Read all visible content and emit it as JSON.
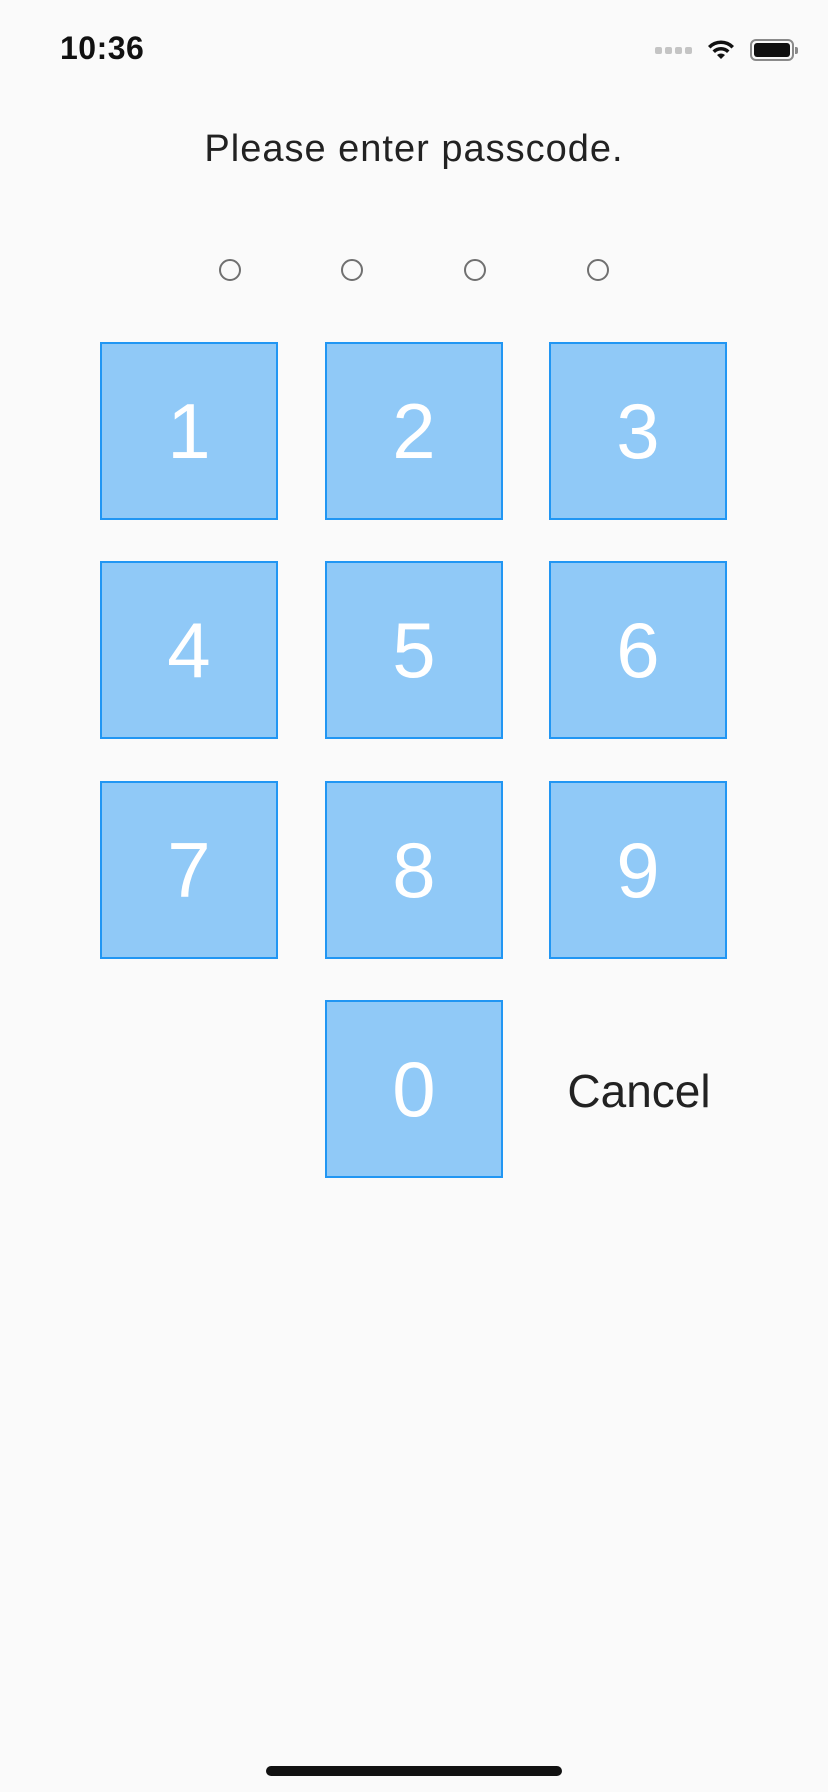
{
  "status_bar": {
    "time": "10:36",
    "icons": [
      "signal-dots-icon",
      "wifi-icon",
      "battery-icon"
    ]
  },
  "prompt": "Please enter passcode.",
  "passcode": {
    "length": 4,
    "entered": 0
  },
  "keypad": {
    "keys": [
      "1",
      "2",
      "3",
      "4",
      "5",
      "6",
      "7",
      "8",
      "9",
      "0"
    ],
    "cancel_label": "Cancel"
  },
  "colors": {
    "key_fill": "#90c9f7",
    "key_border": "#2196f3",
    "key_text": "#ffffff",
    "background": "#fafafa"
  }
}
